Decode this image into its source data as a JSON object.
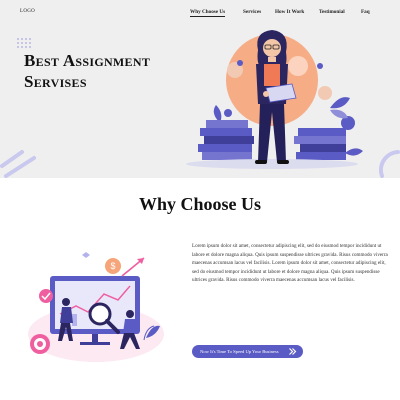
{
  "header": {
    "logo": "LOGO",
    "nav": [
      {
        "label": "Why Choose Us"
      },
      {
        "label": "Services"
      },
      {
        "label": "How It Work"
      },
      {
        "label": "Testimonial"
      },
      {
        "label": "Faq"
      }
    ]
  },
  "hero": {
    "title_line1": "Best Assignment",
    "title_line2": "Servises"
  },
  "why": {
    "title": "Why Choose Us",
    "paragraph": "Lorem ipsum dolor sit amet, consectetur adipiscing elit, sed do eiusmod tempor incididunt ut labore et dolore magna aliqua. Quis ipsum suspendisse ultrices gravida. Risus commodo viverra maecenas accumsan lacus vel facilisis. Lorem ipsum dolor sit amet, consectetur adipiscing elit, sed do eiusmod tempor incididunt ut labore et dolore magna aliqua. Quis ipsum suspendisse ultrices gravida. Risus commodo viverra maecenas accumsan lacus vel facilisis.",
    "cta": "Now It's Time To Speed Up Your Business"
  },
  "icons": {
    "cta_icon": "double-chevron-right-icon"
  },
  "colors": {
    "accent": "#5a5bc4",
    "hero_bg": "#efefef",
    "orange": "#f6a57a"
  }
}
